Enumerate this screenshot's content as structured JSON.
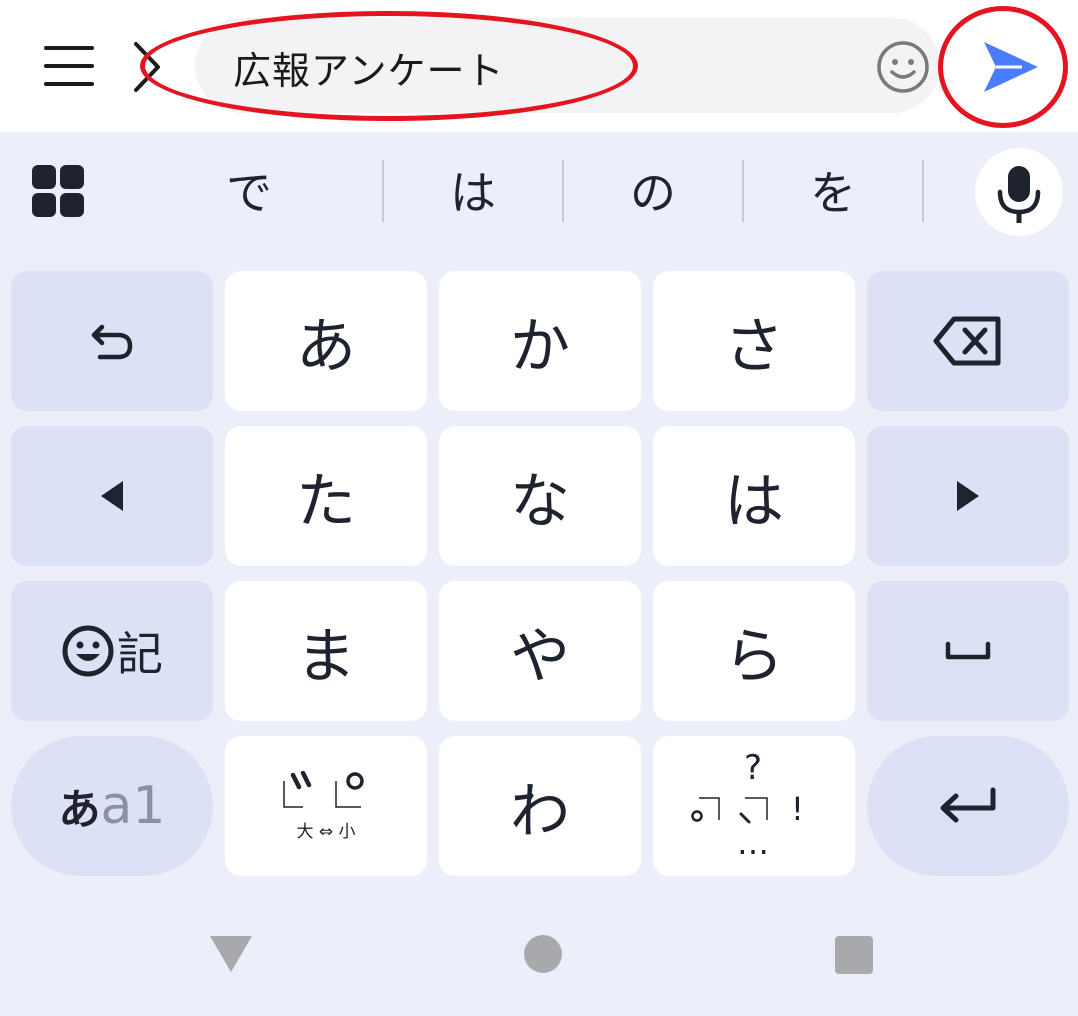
{
  "search": {
    "query": "広報アンケート"
  },
  "candidates": [
    "で",
    "は",
    "の",
    "を"
  ],
  "keys": {
    "row1": [
      "あ",
      "か",
      "さ"
    ],
    "row2": [
      "た",
      "な",
      "は"
    ],
    "row3": [
      "ま",
      "や",
      "ら"
    ],
    "row4_center": "わ"
  },
  "function_keys": {
    "symbol_label": "記",
    "mode_label_kana": "あ",
    "mode_label_alpha": "a1",
    "dakuten_caption": "大 ⇔ 小",
    "punct_question": "?",
    "punct_exclaim": "!",
    "punct_ellipsis": "…"
  },
  "icons": {
    "menu": "menu-icon",
    "back": "chevron-left-icon",
    "emoji": "smiley-icon",
    "send": "send-icon",
    "grid": "grid-icon",
    "mic": "microphone-icon",
    "undo": "undo-icon",
    "backspace": "backspace-icon",
    "cursor_left": "triangle-left-icon",
    "cursor_right": "triangle-right-icon",
    "space": "space-icon",
    "enter": "enter-icon"
  },
  "colors": {
    "accent": "#4a7cff",
    "annotation": "#e4151f",
    "key_bg": "#ffffff",
    "fn_key_bg": "#dde1f6",
    "keyboard_bg": "#eceef9"
  }
}
